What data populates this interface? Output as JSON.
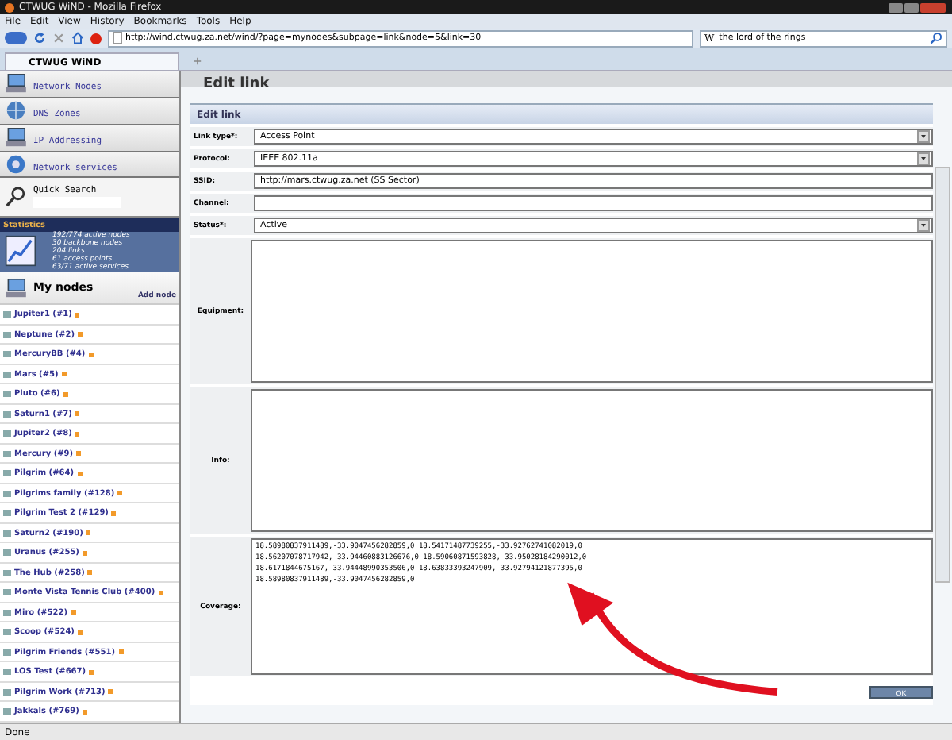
{
  "window": {
    "title": "CTWUG WiND - Mozilla Firefox"
  },
  "menu": [
    "File",
    "Edit",
    "View",
    "History",
    "Bookmarks",
    "Tools",
    "Help"
  ],
  "address": {
    "value": "http://wind.ctwug.za.net/wind/?page=mynodes&subpage=link&node=5&link=30"
  },
  "search": {
    "engine": "W",
    "value": "the lord of the rings"
  },
  "tabs": [
    {
      "label": "CTWUG WiND",
      "selected": true
    }
  ],
  "sidebar": {
    "items": [
      {
        "label": "Network Nodes",
        "kind": "nodes"
      },
      {
        "label": "DNS Zones",
        "kind": "dns"
      },
      {
        "label": "IP Addressing",
        "kind": "ip"
      },
      {
        "label": "Network services",
        "kind": "services"
      }
    ],
    "quick_search": {
      "label": "Quick Search"
    },
    "statistics": {
      "title": "Statistics",
      "lines": [
        "192/774 active nodes",
        "30 backbone nodes",
        "204 links",
        "61 access points",
        "63/71 active services"
      ]
    },
    "my_nodes": {
      "title": "My nodes",
      "add": "Add node",
      "nodes": [
        "Jupiter1 (#1)",
        "Neptune (#2)",
        "MercuryBB (#4)",
        "Mars (#5)",
        "Pluto (#6)",
        "Saturn1 (#7)",
        "Jupiter2 (#8)",
        "Mercury (#9)",
        "Pilgrim (#64)",
        "Pilgrims family (#128)",
        "Pilgrim Test 2 (#129)",
        "Saturn2 (#190)",
        "Uranus (#255)",
        "The Hub (#258)",
        "Monte Vista Tennis Club (#400)",
        "Miro (#522)",
        "Scoop (#524)",
        "Pilgrim Friends (#551)",
        "LOS Test (#667)",
        "Pilgrim Work (#713)",
        "Jakkals (#769)"
      ]
    }
  },
  "page": {
    "title": "Edit link",
    "panel_title": "Edit link",
    "fields": [
      {
        "label": "Link type*:",
        "kind": "select",
        "value": "Access Point"
      },
      {
        "label": "Protocol:",
        "kind": "select",
        "value": "IEEE 802.11a"
      },
      {
        "label": "SSID:",
        "kind": "text",
        "value": "http://mars.ctwug.za.net (SS Sector)"
      },
      {
        "label": "Channel:",
        "kind": "text"
      },
      {
        "label": "Status*:",
        "kind": "select",
        "value": "Active"
      },
      {
        "label": "Equipment:",
        "kind": "textarea"
      },
      {
        "label": "Info:",
        "kind": "textarea"
      },
      {
        "label": "Coverage:",
        "kind": "textarea",
        "value": "18.58980837911489,-33.9047456282859,0 18.54171487739255,-33.92762741082019,0\n18.56207078717942,-33.94460883126676,0 18.59060871593828,-33.95028184290012,0\n18.6171844675167,-33.94448990353506,0 18.63833393247909,-33.92794121877395,0\n18.58980837911489,-33.9047456282859,0"
      }
    ],
    "submit": "OK"
  },
  "status_bar": {
    "text": "Done"
  }
}
